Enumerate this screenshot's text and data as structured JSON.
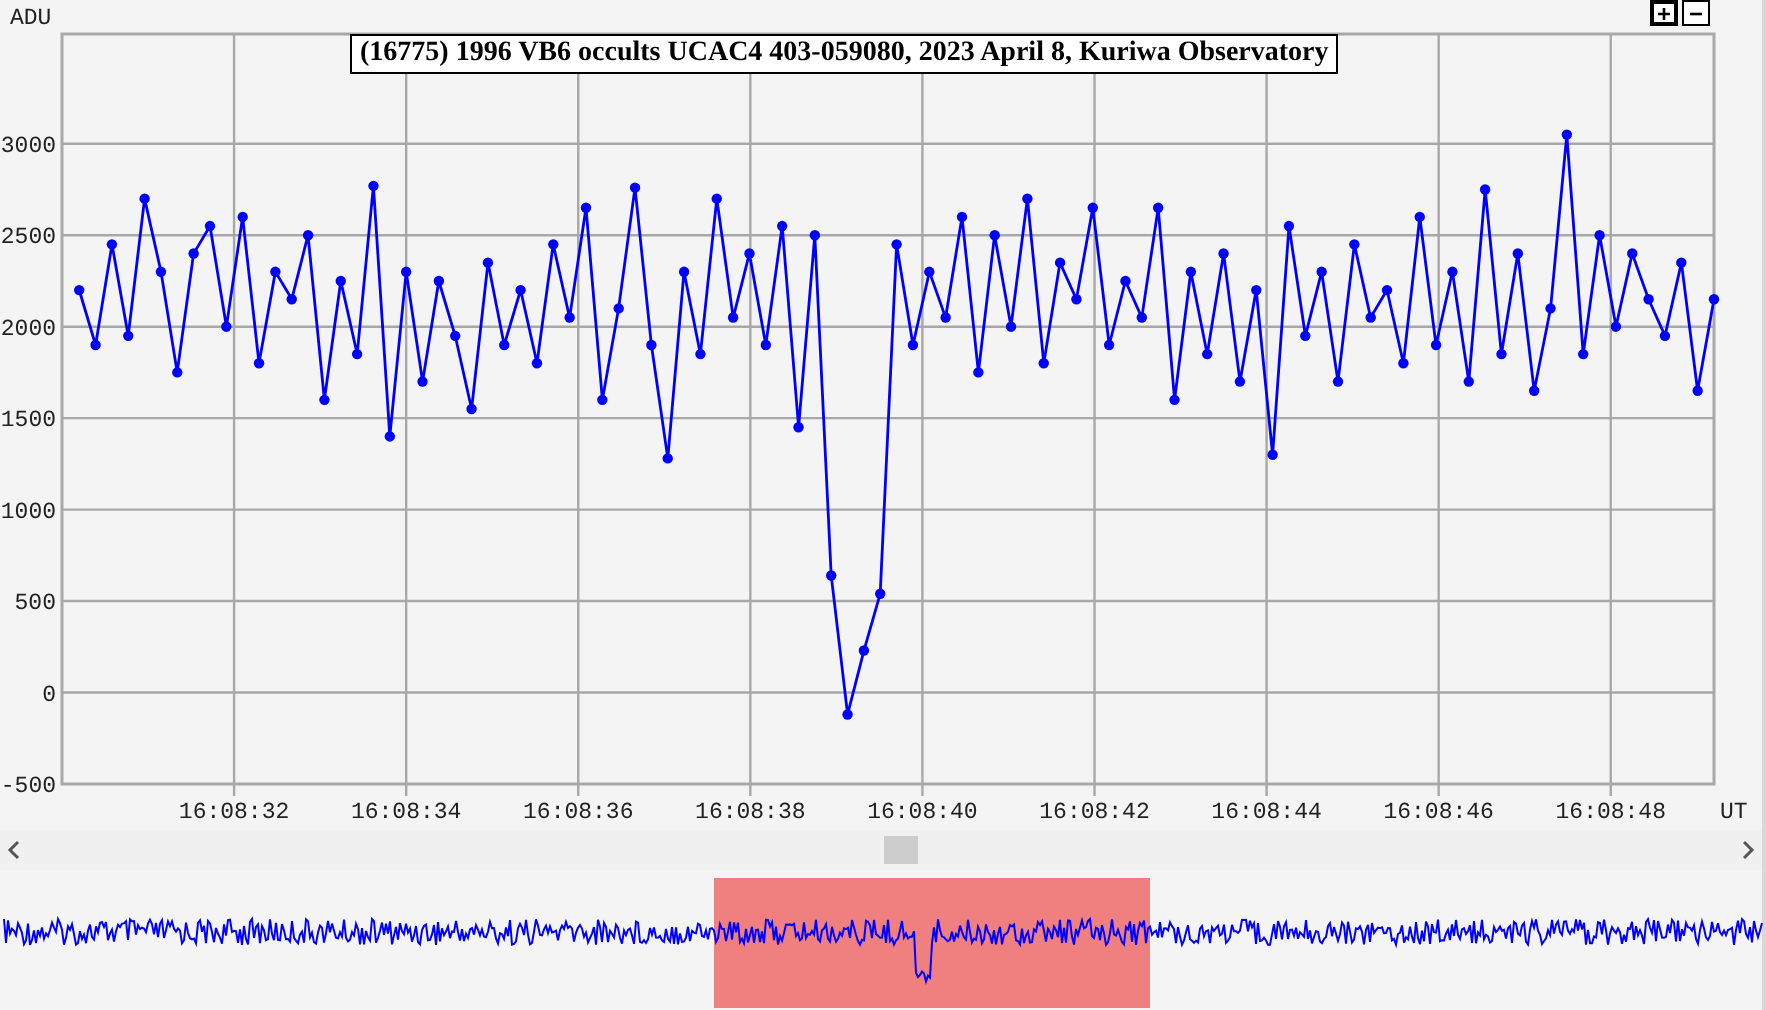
{
  "chart": {
    "title": "(16775) 1996 VB6 occults UCAC4 403-059080, 2023 April 8, Kuriwa Observatory",
    "zoom_buttons": [
      {
        "label": "+",
        "focused": true
      },
      {
        "label": "−",
        "focused": false
      }
    ],
    "chart_data": {
      "type": "line",
      "xlabel": "UT",
      "ylabel": "ADU",
      "grid": true,
      "xlim": [
        58110,
        58129.2
      ],
      "ylim": [
        -500,
        3600
      ],
      "yticks": [
        -500,
        0,
        500,
        1000,
        1500,
        2000,
        2500,
        3000
      ],
      "xticks": [
        {
          "value": 58112,
          "label": "16:08:32"
        },
        {
          "value": 58114,
          "label": "16:08:34"
        },
        {
          "value": 58116,
          "label": "16:08:36"
        },
        {
          "value": 58118,
          "label": "16:08:38"
        },
        {
          "value": 58120,
          "label": "16:08:40"
        },
        {
          "value": 58122,
          "label": "16:08:42"
        },
        {
          "value": 58124,
          "label": "16:08:44"
        },
        {
          "value": 58126,
          "label": "16:08:46"
        },
        {
          "value": 58128,
          "label": "16:08:48"
        }
      ],
      "x": [
        58110.2,
        58110.39,
        58110.58,
        58110.77,
        58110.96,
        58111.15,
        58111.34,
        58111.53,
        58111.72,
        58111.91,
        58112.1,
        58112.29,
        58112.48,
        58112.67,
        58112.86,
        58113.05,
        58113.24,
        58113.43,
        58113.62,
        58113.81,
        58114.0,
        58114.19,
        58114.38,
        58114.57,
        58114.76,
        58114.95,
        58115.14,
        58115.33,
        58115.52,
        58115.71,
        58115.9,
        58116.09,
        58116.28,
        58116.47,
        58116.66,
        58116.85,
        58117.04,
        58117.23,
        58117.42,
        58117.61,
        58117.8,
        58117.99,
        58118.18,
        58118.37,
        58118.56,
        58118.75,
        58118.94,
        58119.13,
        58119.32,
        58119.51,
        58119.7,
        58119.89,
        58120.08,
        58120.27,
        58120.46,
        58120.65,
        58120.84,
        58121.03,
        58121.22,
        58121.41,
        58121.6,
        58121.79,
        58121.98,
        58122.17,
        58122.36,
        58122.55,
        58122.74,
        58122.93,
        58123.12,
        58123.31,
        58123.5,
        58123.69,
        58123.88,
        58124.07,
        58124.26,
        58124.45,
        58124.64,
        58124.83,
        58125.02,
        58125.21,
        58125.4,
        58125.59,
        58125.78,
        58125.97,
        58126.16,
        58126.35,
        58126.54,
        58126.73,
        58126.92,
        58127.11,
        58127.3,
        58127.49,
        58127.68,
        58127.87,
        58128.06,
        58128.25,
        58128.44,
        58128.63,
        58128.82,
        58129.01,
        58129.2
      ],
      "series": [
        {
          "color": "#0000ff",
          "marker": "circle",
          "values": [
            2200,
            1900,
            2450,
            1950,
            2700,
            2300,
            1750,
            2400,
            2550,
            2000,
            2600,
            1800,
            2300,
            2150,
            2500,
            1600,
            2250,
            1850,
            2770,
            1400,
            2300,
            1700,
            2250,
            1950,
            1550,
            2350,
            1900,
            2200,
            1800,
            2450,
            2050,
            2650,
            1600,
            2100,
            2760,
            1900,
            1280,
            2300,
            1850,
            2700,
            2050,
            2400,
            1900,
            2550,
            1450,
            2500,
            640,
            -120,
            230,
            540,
            2450,
            1900,
            2300,
            2050,
            2600,
            1750,
            2500,
            2000,
            2700,
            1800,
            2350,
            2150,
            2650,
            1900,
            2250,
            2050,
            2650,
            1600,
            2300,
            1850,
            2400,
            1700,
            2200,
            1300,
            2550,
            1950,
            2300,
            1700,
            2450,
            2050,
            2200,
            1800,
            2600,
            1900,
            2300,
            1700,
            2750,
            1850,
            2400,
            1650,
            2100,
            3050,
            1850,
            2500,
            2000,
            2400,
            2150,
            1950,
            2350,
            1650,
            2150
          ]
        }
      ]
    }
  }
}
